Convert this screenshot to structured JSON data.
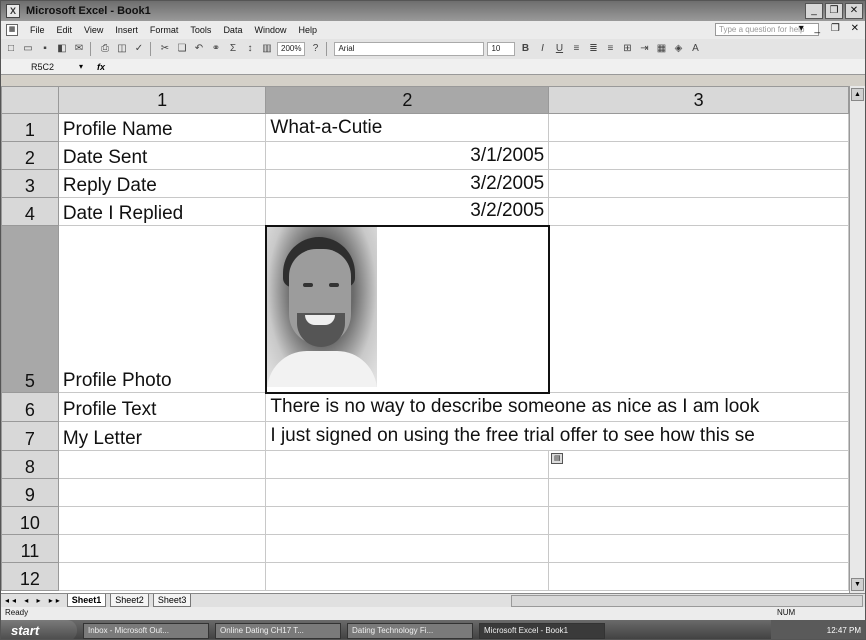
{
  "window": {
    "title": "Microsoft Excel - Book1",
    "app_icon": "X"
  },
  "menu": {
    "items": [
      "File",
      "Edit",
      "View",
      "Insert",
      "Format",
      "Tools",
      "Data",
      "Window",
      "Help"
    ],
    "help_placeholder": "Type a question for help"
  },
  "toolbar": {
    "zoom": "200%",
    "font": "Arial",
    "size": "10"
  },
  "formula_bar": {
    "name_box": "R5C2",
    "fx": "fx"
  },
  "columns": [
    "1",
    "2",
    "3"
  ],
  "rows": [
    {
      "num": "1",
      "c1": "Profile Name",
      "c2": "What-a-Cutie"
    },
    {
      "num": "2",
      "c1": "Date Sent",
      "c2": "3/1/2005"
    },
    {
      "num": "3",
      "c1": "Reply Date",
      "c2": "3/2/2005"
    },
    {
      "num": "4",
      "c1": "Date I Replied",
      "c2": "3/2/2005"
    },
    {
      "num": "5",
      "c1": "Profile Photo",
      "c2": ""
    },
    {
      "num": "6",
      "c1": "Profile Text",
      "c2": "There is no way to describe someone as nice as I am look"
    },
    {
      "num": "7",
      "c1": "My Letter",
      "c2": "I just signed on using the free trial offer to see how this se"
    },
    {
      "num": "8",
      "c1": "",
      "c2": ""
    },
    {
      "num": "9",
      "c1": "",
      "c2": ""
    },
    {
      "num": "10",
      "c1": "",
      "c2": ""
    },
    {
      "num": "11",
      "c1": "",
      "c2": ""
    },
    {
      "num": "12",
      "c1": "",
      "c2": ""
    }
  ],
  "sheet_tabs": [
    "Sheet1",
    "Sheet2",
    "Sheet3"
  ],
  "status": {
    "left": "Ready",
    "right": "NUM"
  },
  "taskbar": {
    "start": "start",
    "tasks": [
      "Inbox - Microsoft Out...",
      "Online Dating CH17 T...",
      "Dating Technology Fi...",
      "Microsoft Excel - Book1"
    ],
    "clock": "12:47 PM"
  }
}
